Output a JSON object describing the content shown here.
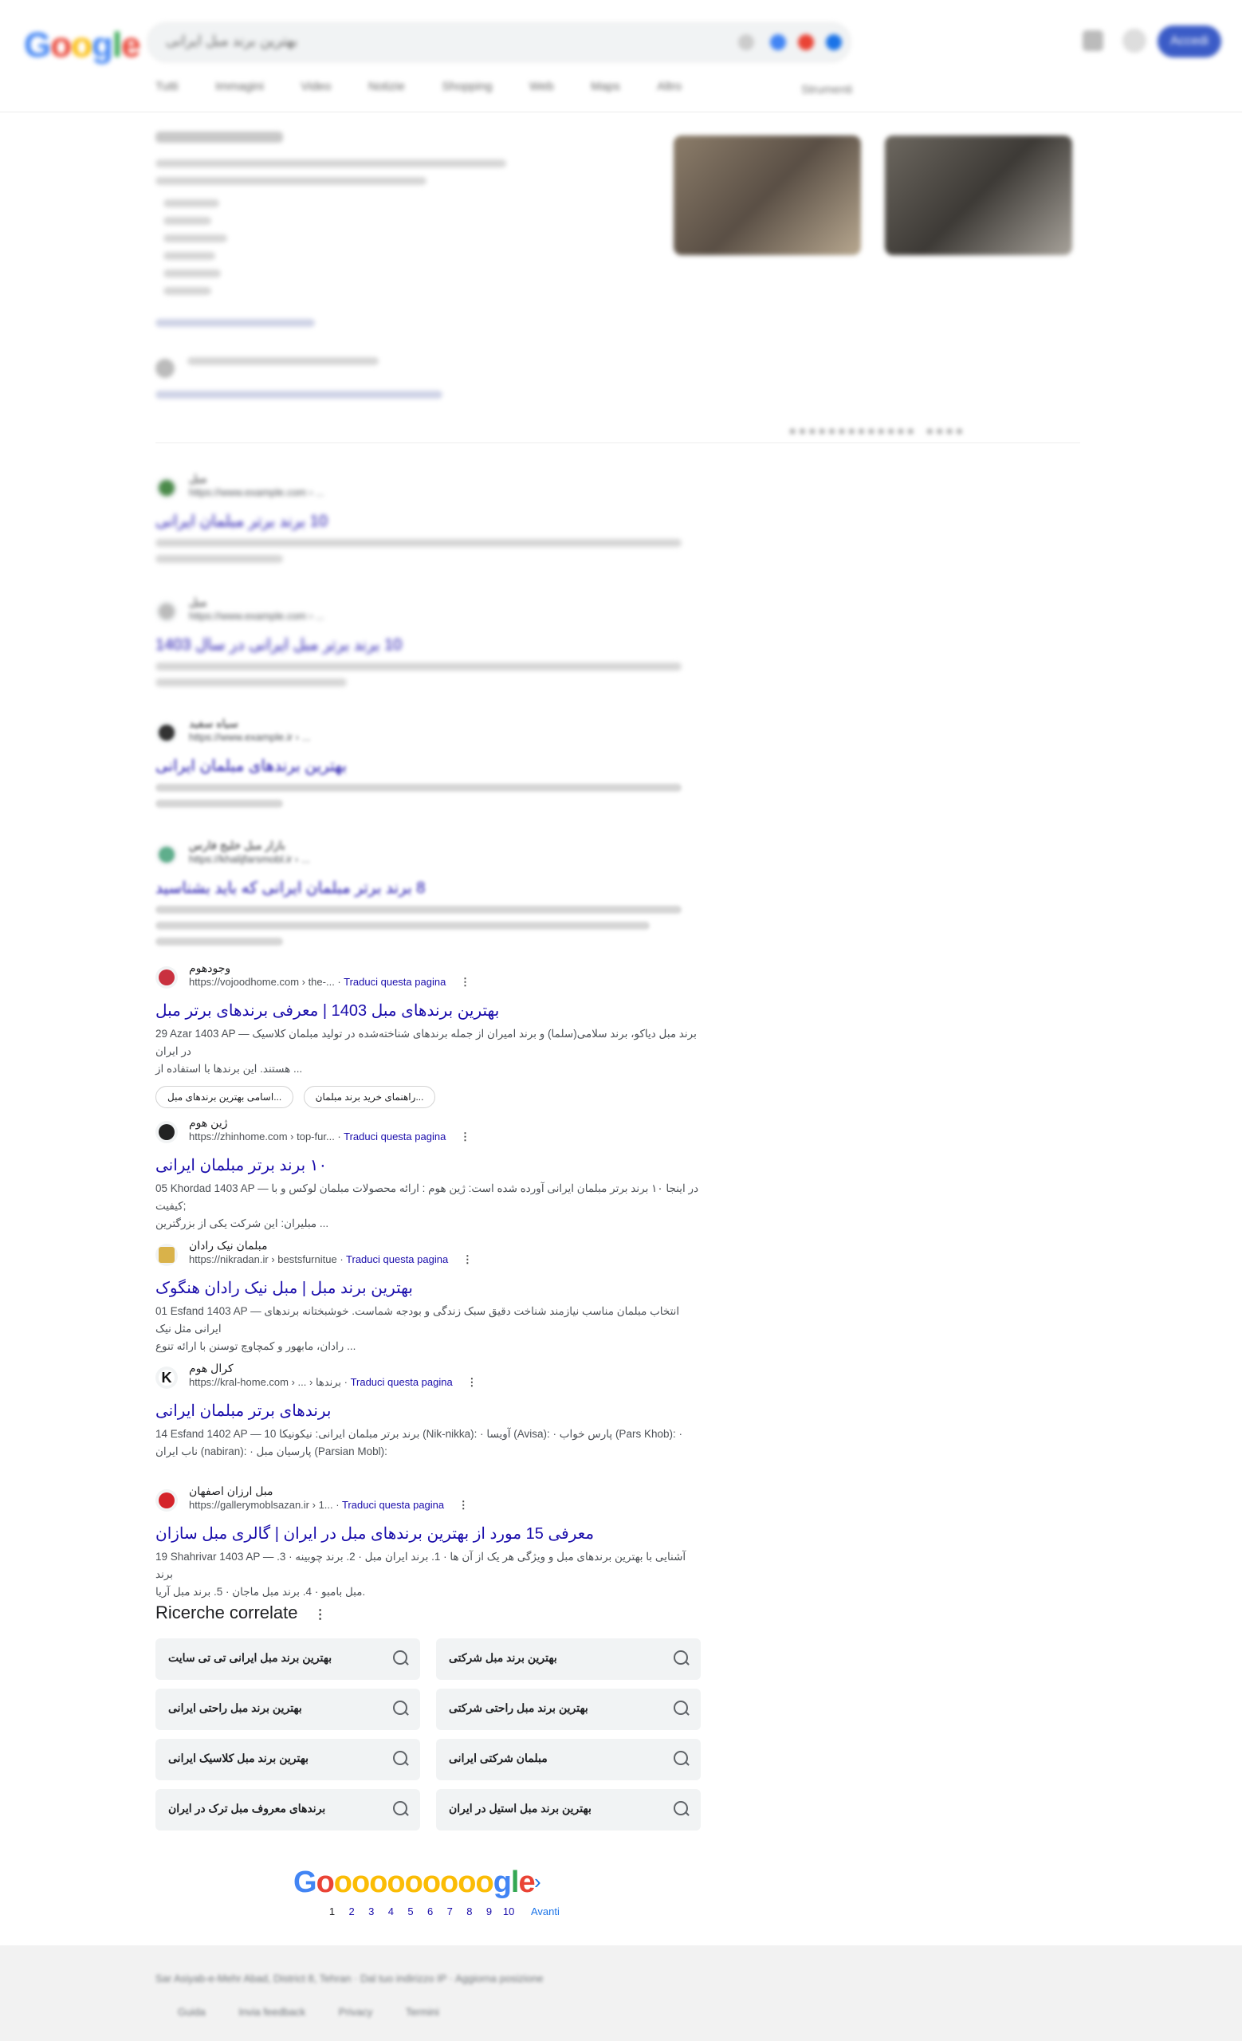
{
  "header": {
    "logo": "Google",
    "search_query": "بهترین برند مبل ایرانی",
    "signin_label": "Accedi",
    "tabs": [
      "Tutti",
      "Immagini",
      "Video",
      "Notizie",
      "Shopping",
      "Web",
      "Maps",
      "Altro"
    ],
    "tools_label": "Strumenti"
  },
  "blurred_results": [
    {
      "site": "مبل",
      "url": "https://www.example.com › ...",
      "title": "10 برند برتر مبلمان ایرانی"
    },
    {
      "site": "مبل",
      "url": "https://www.example.com › ...",
      "title": "10 برند برتر مبل ایرانی در سال 1403"
    },
    {
      "site": "سیاه سفید",
      "url": "https://www.example.ir › ...",
      "title": "بهترین برندهای مبلمان ایرانی"
    },
    {
      "site": "بازار مبل خلیج فارس",
      "url": "https://khalijfarsmobl.ir › ...",
      "title": "8 برند برتر مبلمان ایرانی که باید بشناسید"
    }
  ],
  "results": [
    {
      "site": "وجودهوم",
      "url": "https://vojoodhome.com › the-...",
      "translate": "Traduci questa pagina",
      "title": "بهترین برندهای مبل 1403 | معرفی برندهای برتر مبل",
      "snippet1": "29 Azar 1403 AP — برند مبل دیاکو، برند سلامی(سلما) و برند امیران از جمله برندهای شناخته‌شده در تولید مبلمان کلاسیک در ایران",
      "snippet2": "هستند. این برندها با استفاده از ...",
      "chips": [
        "اسامی بهترین برندهای مبل...",
        "راهنمای خرید برند مبلمان..."
      ],
      "favicon_color": "#c9313f"
    },
    {
      "site": "ژین هوم",
      "url": "https://zhinhome.com › top-fur...",
      "translate": "Traduci questa pagina",
      "title": "۱۰ برند برتر مبلمان ایرانی",
      "snippet1": "05 Khordad 1403 AP — در اینجا ۱۰ برند برتر مبلمان ایرانی آورده شده است: ژین هوم : ارائه محصولات مبلمان لوکس و با کیفیت;",
      "snippet2": "مبلیران: این شرکت یکی از بزرگترین ...",
      "favicon_color": "#222222"
    },
    {
      "site": "مبلمان نیک رادان",
      "url": "https://nikradan.ir › bestsfurnitue",
      "translate": "Traduci questa pagina",
      "title": "بهترین برند مبل | مبل نیک رادان هنگوک",
      "snippet1": "01 Esfand 1403 AP — انتخاب مبلمان مناسب نیازمند شناخت دقیق سبک زندگی و بودجه شماست. خوشبختانه برندهای ایرانی مثل نیک",
      "snippet2": "رادان، مابهور و کمچاوچ توسنن با ارائه تنوع ...",
      "favicon_color": "#d9b24a"
    },
    {
      "site": "کرال هوم",
      "url": "https://kral-home.com › ... › برندها",
      "translate": "Traduci questa pagina",
      "title": "برندهای برتر مبلمان ایرانی",
      "snippet1": "14 Esfand 1402 AP — 10 برند برتر مبلمان ایرانی: نیکونیکا (Nik-nikka): · آویسا (Avisa): · پارس خواب (Pars Khob): ·",
      "snippet2": "ناب ایران (nabiran): · پارسیان مبل (Parsian Mobl):",
      "favicon_color": "#111111"
    },
    {
      "site": "مبل ارزان اصفهان",
      "url": "https://gallerymoblsazan.ir › 1...",
      "translate": "Traduci questa pagina",
      "title": "معرفی 15 مورد از بهترین برندهای مبل در ایران | گالری مبل سازان",
      "snippet1": "19 Shahrivar 1403 AP — آشنایی با بهترین برندهای مبل و ویژگی هر یک از آن ها · 1. برند ایران مبل · 2. برند چوبینه · 3. برند",
      "snippet2": "مبل بامبو · 4. برند مبل ماجان · 5. برند مبل آریا.",
      "favicon_color": "#d4232a"
    }
  ],
  "related": {
    "title": "Ricerche correlate",
    "items": [
      "بهترین برند مبل ایرانی تی تی سایت",
      "بهترین برند مبل شرکتی",
      "بهترین برند مبل راحتی ایرانی",
      "بهترین برند مبل راحتی شرکتی",
      "بهترین برند مبل کلاسیک ایرانی",
      "مبلمان شرکتی ایرانی",
      "برندهای معروف مبل ترک در ایران",
      "بهترین برند مبل استیل در ایران"
    ]
  },
  "pagination": {
    "logo": "Goooooooooogle",
    "pages": [
      "1",
      "2",
      "3",
      "4",
      "5",
      "6",
      "7",
      "8",
      "9",
      "10"
    ],
    "next": "Avanti"
  },
  "footer": {
    "location": "Sar Asiyab-e-Mehr Abad, District 8, Tehran · Dal tuo indirizzo IP · Aggiorna posizione",
    "links": [
      "Guida",
      "Invia feedback",
      "Privacy",
      "Termini"
    ]
  },
  "colors": {
    "link": "#1a0dab",
    "accent": "#1a73e8",
    "signin": "#3b5cc7"
  }
}
